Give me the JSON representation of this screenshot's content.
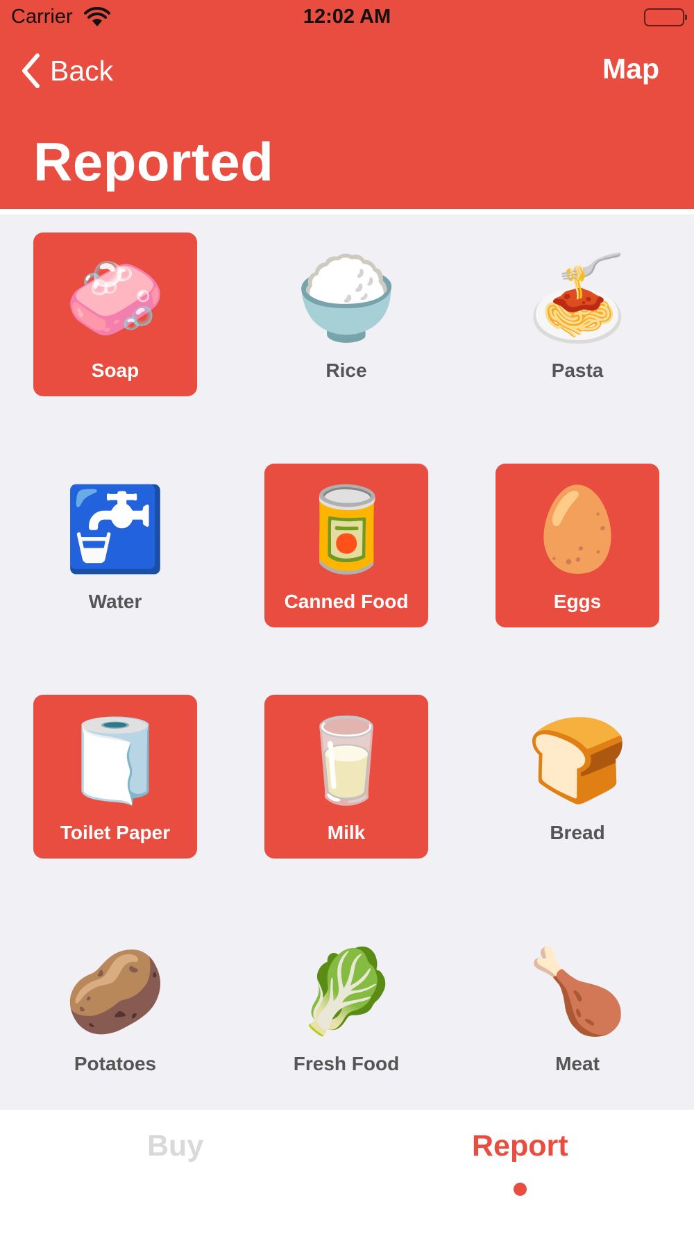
{
  "status_bar": {
    "carrier": "Carrier",
    "time": "12:02 AM"
  },
  "nav": {
    "back_label": "Back",
    "map_label": "Map"
  },
  "page_title": "Reported",
  "colors": {
    "accent": "#e84d40",
    "background": "#f1f0f4",
    "label_gray": "#555555",
    "inactive_tab": "#d9d9d9"
  },
  "items": [
    {
      "label": "Soap",
      "emoji": "🧼",
      "icon": "soap-icon",
      "reported": true
    },
    {
      "label": "Rice",
      "emoji": "🍚",
      "icon": "rice-icon",
      "reported": false
    },
    {
      "label": "Pasta",
      "emoji": "🍝",
      "icon": "pasta-icon",
      "reported": false
    },
    {
      "label": "Water",
      "emoji": "🚰",
      "icon": "water-tap-icon",
      "reported": false
    },
    {
      "label": "Canned Food",
      "emoji": "🥫",
      "icon": "canned-food-icon",
      "reported": true
    },
    {
      "label": "Eggs",
      "emoji": "🥚",
      "icon": "egg-icon",
      "reported": true
    },
    {
      "label": "Toilet Paper",
      "emoji": "🧻",
      "icon": "toilet-paper-icon",
      "reported": true
    },
    {
      "label": "Milk",
      "emoji": "🥛",
      "icon": "milk-icon",
      "reported": true
    },
    {
      "label": "Bread",
      "emoji": "🍞",
      "icon": "bread-icon",
      "reported": false
    },
    {
      "label": "Potatoes",
      "emoji": "🥔",
      "icon": "potato-icon",
      "reported": false
    },
    {
      "label": "Fresh Food",
      "emoji": "🥬",
      "icon": "lettuce-icon",
      "reported": false
    },
    {
      "label": "Meat",
      "emoji": "🍗",
      "icon": "drumstick-icon",
      "reported": false
    }
  ],
  "tabs": {
    "buy_label": "Buy",
    "report_label": "Report",
    "active": "Report"
  }
}
